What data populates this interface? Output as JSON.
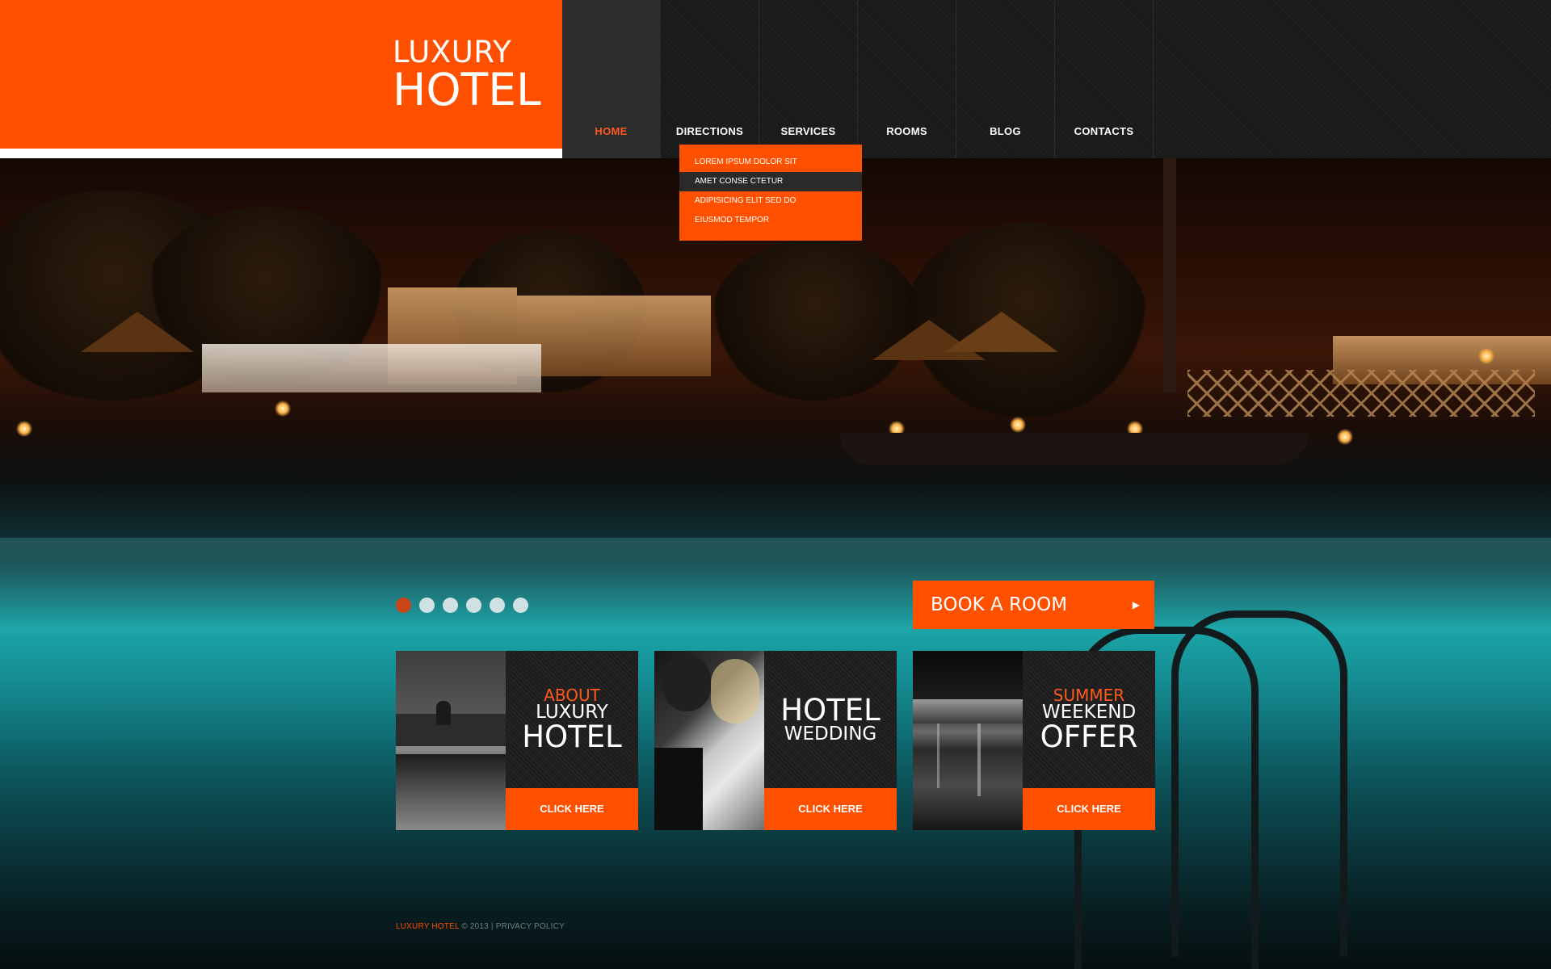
{
  "logo": {
    "line1": "LUXURY",
    "line2": "HOTEL"
  },
  "nav": {
    "items": [
      {
        "label": "HOME"
      },
      {
        "label": "DIRECTIONS"
      },
      {
        "label": "SERVICES"
      },
      {
        "label": "ROOMS"
      },
      {
        "label": "BLOG"
      },
      {
        "label": "CONTACTS"
      }
    ],
    "active_index": 0
  },
  "dropdown": {
    "items": [
      {
        "label": "LOREM IPSUM DOLOR SIT"
      },
      {
        "label": "AMET CONSE CTETUR"
      },
      {
        "label": "ADIPISICING ELIT SED DO"
      },
      {
        "label": "EIUSMOD TEMPOR"
      }
    ],
    "active_index": 1
  },
  "slider": {
    "dot_count": 6,
    "active_index": 0
  },
  "book_button": {
    "label": "BOOK A ROOM",
    "arrow_icon": "caret-right-icon"
  },
  "cards": [
    {
      "line1": "ABOUT",
      "line2": "LUXURY",
      "line3": "HOTEL",
      "button": "CLICK HERE"
    },
    {
      "line1": "HOTEL",
      "line2": "WEDDING",
      "button": "CLICK HERE"
    },
    {
      "line1": "SUMMER",
      "line2": "WEEKEND",
      "line3": "OFFER",
      "button": "CLICK HERE"
    }
  ],
  "footer": {
    "brand": "LUXURY HOTEL",
    "copyright": "© 2013 |",
    "privacy": "PRIVACY POLICY"
  },
  "colors": {
    "accent": "#ff5000",
    "nav_bg": "#1c1c1c",
    "active_nav_text": "#ff5a1a",
    "dot_inactive": "#cfe1e3",
    "dot_active": "#c9461a"
  }
}
